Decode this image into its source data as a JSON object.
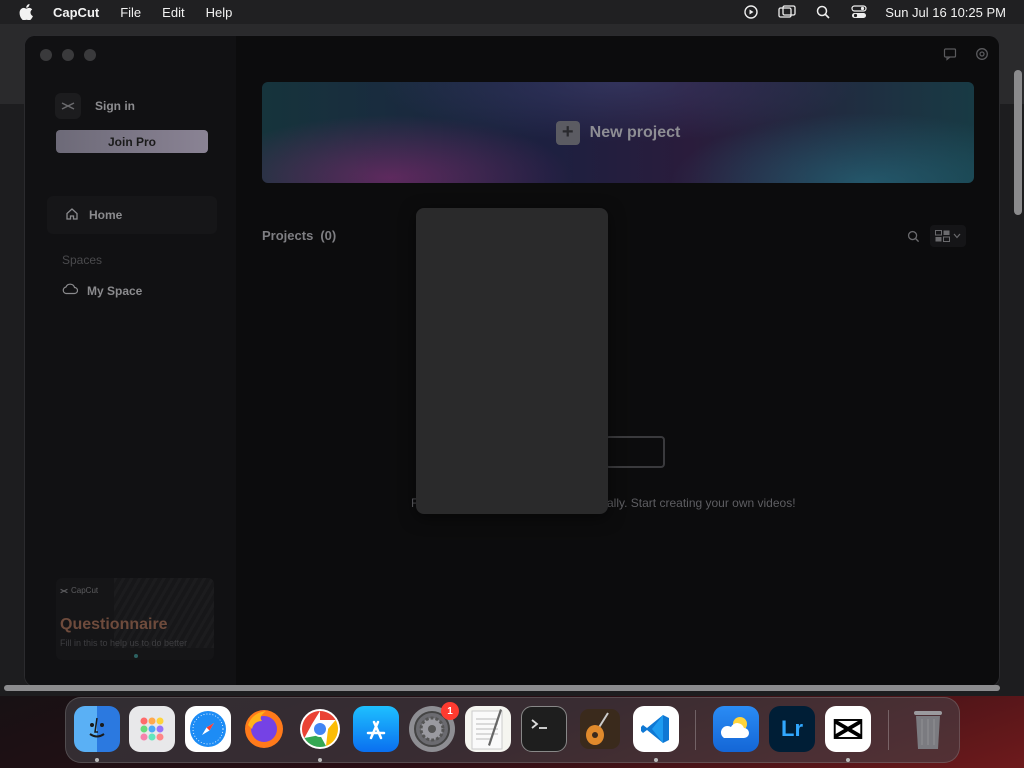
{
  "menubar": {
    "app_name": "CapCut",
    "menus": [
      "File",
      "Edit",
      "Help"
    ],
    "clock": "Sun Jul 16  10:25 PM",
    "status_icons": [
      "screen-record-icon",
      "screen-mirror-icon",
      "spotlight-search-icon",
      "control-center-icon"
    ]
  },
  "sidebar": {
    "sign_in": "Sign in",
    "join_pro": "Join Pro",
    "home": "Home",
    "spaces_label": "Spaces",
    "my_space": "My Space",
    "questionnaire": {
      "brand": "CapCut",
      "title": "Questionnaire",
      "subtitle": "Fill in this to help us to do better"
    }
  },
  "main": {
    "new_project": "New project",
    "projects_label": "Projects",
    "projects_count": "(0)",
    "empty_text": "ically. Start creating your own videos!",
    "empty_text_prefix": "F"
  },
  "dock": {
    "items": [
      {
        "name": "Finder",
        "icon": "finder-icon"
      },
      {
        "name": "Launchpad",
        "icon": "launchpad-icon"
      },
      {
        "name": "Safari",
        "icon": "safari-icon"
      },
      {
        "name": "Firefox",
        "icon": "firefox-icon"
      },
      {
        "name": "Chrome",
        "icon": "chrome-icon"
      },
      {
        "name": "App Store",
        "icon": "app-store-icon"
      },
      {
        "name": "System Settings",
        "icon": "system-settings-icon",
        "badge": "1"
      },
      {
        "name": "TextEdit",
        "icon": "textedit-icon"
      },
      {
        "name": "Terminal",
        "icon": "terminal-icon"
      },
      {
        "name": "GarageBand",
        "icon": "garageband-icon"
      },
      {
        "name": "VS Code",
        "icon": "vscode-icon"
      },
      {
        "name": "Weather",
        "icon": "weather-icon"
      },
      {
        "name": "Lightroom",
        "icon": "lightroom-icon",
        "label": "Lr"
      },
      {
        "name": "CapCut",
        "icon": "capcut-icon"
      },
      {
        "name": "Trash",
        "icon": "trash-icon"
      }
    ]
  },
  "colors": {
    "accent_pro": "#8a8394",
    "badge": "#ff3b30"
  }
}
